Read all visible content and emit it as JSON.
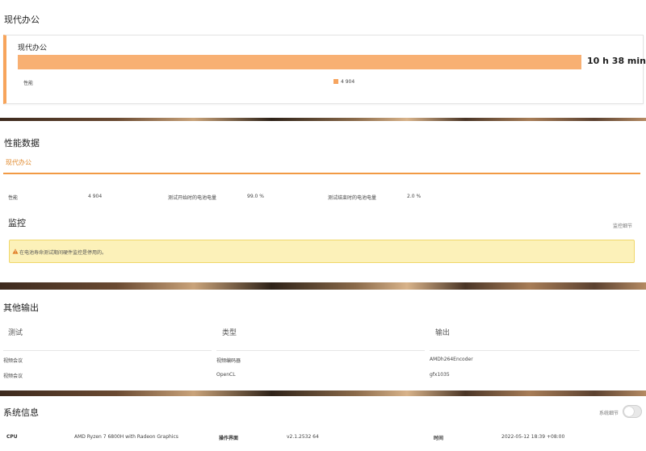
{
  "colors": {
    "accent": "#f29a45",
    "bar": "#f8b073",
    "alert_bg": "#fcf1b9",
    "alert_border": "#f0d76a",
    "warning": "#e07a1f"
  },
  "section1": {
    "title": "现代办公",
    "card": {
      "label": "现代办公",
      "duration": "10 h 38 min",
      "warning_icon": "warning-triangle-icon",
      "score_label": "性能",
      "score_value": "4 904",
      "bar_fill": 1.0
    }
  },
  "section2": {
    "title": "性能数据",
    "tab_label": "现代办公",
    "row": {
      "perf_label": "性能",
      "perf_value": "4 904",
      "start_label": "测试开始时的电池电量",
      "start_value": "99.0 %",
      "end_label": "测试结束时的电池电量",
      "end_value": "2.0 %"
    },
    "monitor_title": "监控",
    "monitor_link": "监控细节",
    "alert_icon": "warning-triangle-icon",
    "alert_text": "在电池寿命测试期间硬件监控是停用的。"
  },
  "section3": {
    "title": "其他输出",
    "headers": [
      "测试",
      "类型",
      "输出"
    ],
    "rows": [
      [
        "视频会议",
        "视频编码器",
        "AMDh264Encoder"
      ],
      [
        "视频会议",
        "OpenCL",
        "gfx1035"
      ]
    ]
  },
  "section4": {
    "title": "系统信息",
    "toggle_label": "系统细节",
    "cpu_label": "CPU",
    "cpu_value": "AMD Ryzen 7 6800H with Radeon Graphics",
    "os_label": "操作界面",
    "os_value": "v2.1.2532 64",
    "time_label": "时间",
    "time_value": "2022-05-12 18:39 +08:00"
  }
}
